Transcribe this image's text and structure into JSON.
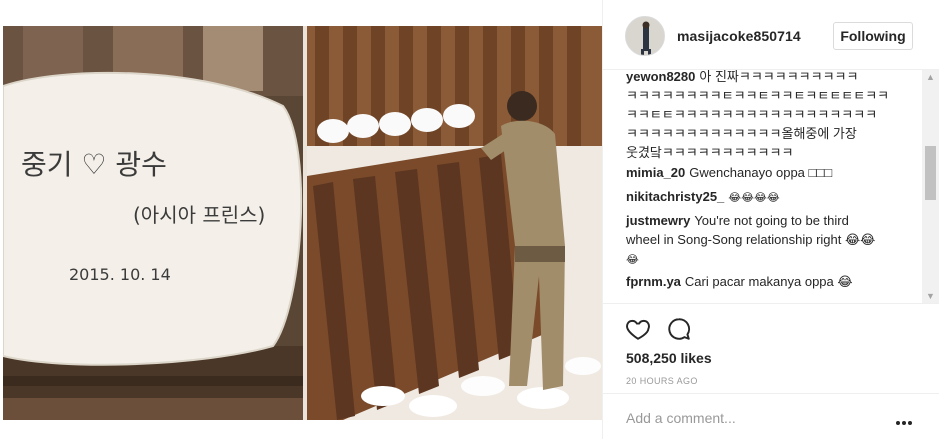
{
  "header": {
    "username": "masijacoke850714",
    "follow_label": "Following"
  },
  "photo": {
    "stone_inscription": {
      "line1": "중기 ♡ 광수",
      "line2": "(아시아 프린스)",
      "line3": "2015. 10. 14"
    }
  },
  "comments": [
    {
      "user": "yewon8280",
      "text": "아 진짜ㅋㅋㅋㅋㅋㅋㅋㅋㅋㅋ"
    },
    {
      "user": "",
      "text": "ㅋㅋㅋㅋㅋㅋㅋㅋㅌㅋㅋㅌㅋㅋㅌㅋㅌㅌㅌㅌㅋㅋ"
    },
    {
      "user": "",
      "text": "ㅋㅋㅌㅌㅋㅋㅋㅋㅋㅋㅋㅋㅋㅋㅋㅋㅋㅋㅋㅋㅋ"
    },
    {
      "user": "",
      "text": "ㅋㅋㅋㅋㅋㅋㅋㅋㅋㅋㅋㅋㅋ올해중에 가장"
    },
    {
      "user": "",
      "text": "웃겼닼ㅋㅋㅋㅋㅋㅋㅋㅋㅋㅋㅋ"
    },
    {
      "user": "mimia_20",
      "text": "Gwenchanayo oppa □□□"
    },
    {
      "user": "nikitachristy25_",
      "text": "😂😂😂😂"
    },
    {
      "user": "justmewry",
      "text": "You're not going to be third"
    },
    {
      "user": "",
      "text": "wheel in Song-Song relationship right 😂😂"
    },
    {
      "user": "",
      "text": "😂"
    },
    {
      "user": "fprnm.ya",
      "text": "Cari pacar makanya oppa 😂"
    }
  ],
  "actions": {
    "like_icon": "heart-outline-icon",
    "comment_icon": "speech-bubble-icon",
    "likes_text": "508,250 likes",
    "timestamp": "20 HOURS AGO"
  },
  "add_comment": {
    "placeholder": "Add a comment...",
    "more_icon": "ellipsis-icon"
  },
  "colors": {
    "text": "#262626",
    "muted": "#999999",
    "border": "#efefef",
    "rust": "#7a4a2a",
    "stone": "#f3efe8"
  }
}
